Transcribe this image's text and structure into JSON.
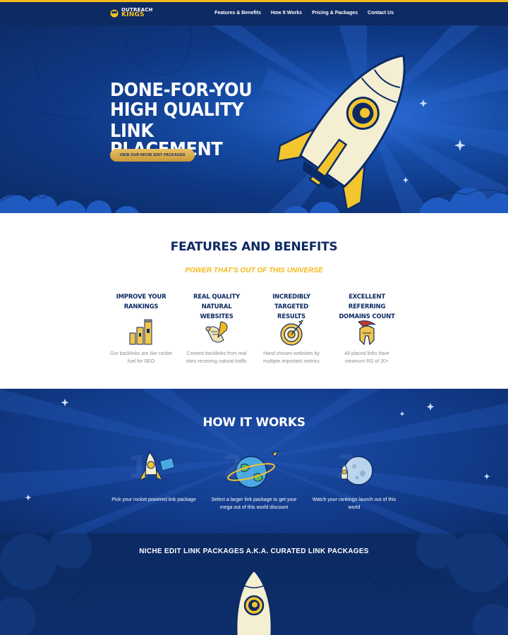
{
  "brand": {
    "line1": "OUTREACH",
    "line2": "KINGS"
  },
  "nav": {
    "items": [
      {
        "label": "Features & Benefits"
      },
      {
        "label": "How It Works"
      },
      {
        "label": "Pricing & Packages"
      },
      {
        "label": "Contact Us"
      }
    ]
  },
  "hero": {
    "title_lines": [
      "DONE-FOR-YOU",
      "HIGH QUALITY LINK",
      "PLACEMENT"
    ],
    "cta_label": "VIEW OUR NICHE EDIT PACKAGES"
  },
  "features": {
    "title": "FEATURES AND BENEFITS",
    "subtitle": "POWER THAT'S OUT OF THIS UNIVERSE",
    "items": [
      {
        "title_lines": [
          "IMPROVE YOUR",
          "RANKINGS"
        ],
        "text_lines": [
          "Our backlinks are like rocket",
          "fuel for SEO"
        ],
        "icon": "castle-icon"
      },
      {
        "title_lines": [
          "REAL QUALITY NATURAL",
          "WEBSITES"
        ],
        "text_lines": [
          "Content backlinks from real",
          "sites receiving natural traffic"
        ],
        "icon": "scroll-quill-icon"
      },
      {
        "title_lines": [
          "INCREDIBLY TARGETED",
          "RESULTS"
        ],
        "text_lines": [
          "Hand chosen websites by",
          "multiple important metrics"
        ],
        "icon": "target-icon"
      },
      {
        "title_lines": [
          "EXCELLENT REFERRING",
          "DOMAINS COUNT"
        ],
        "text_lines": [
          "All placed links have",
          "minimum RD of 20+"
        ],
        "icon": "spartan-helmet-icon"
      }
    ]
  },
  "how": {
    "title": "HOW IT WORKS",
    "steps": [
      {
        "number": "1",
        "text_lines": [
          "Pick your rocket powered link package"
        ],
        "icon": "rocket-ticket-icon"
      },
      {
        "number": "2",
        "text_lines": [
          "Select a larger link package to get your",
          "mega out of this world discount"
        ],
        "icon": "earth-rocket-icon"
      },
      {
        "number": "3",
        "text_lines": [
          "Watch your rankings launch out of this",
          "world"
        ],
        "icon": "moon-rocket-icon"
      }
    ]
  },
  "packages": {
    "title": "NICHE EDIT LINK PACKAGES A.K.A. CURATED LINK PACKAGES"
  },
  "colors": {
    "navy": "#0e2a63",
    "gold": "#f2b81b",
    "hero_blue": "#1650b4",
    "text_gray": "#8e8e8e"
  }
}
